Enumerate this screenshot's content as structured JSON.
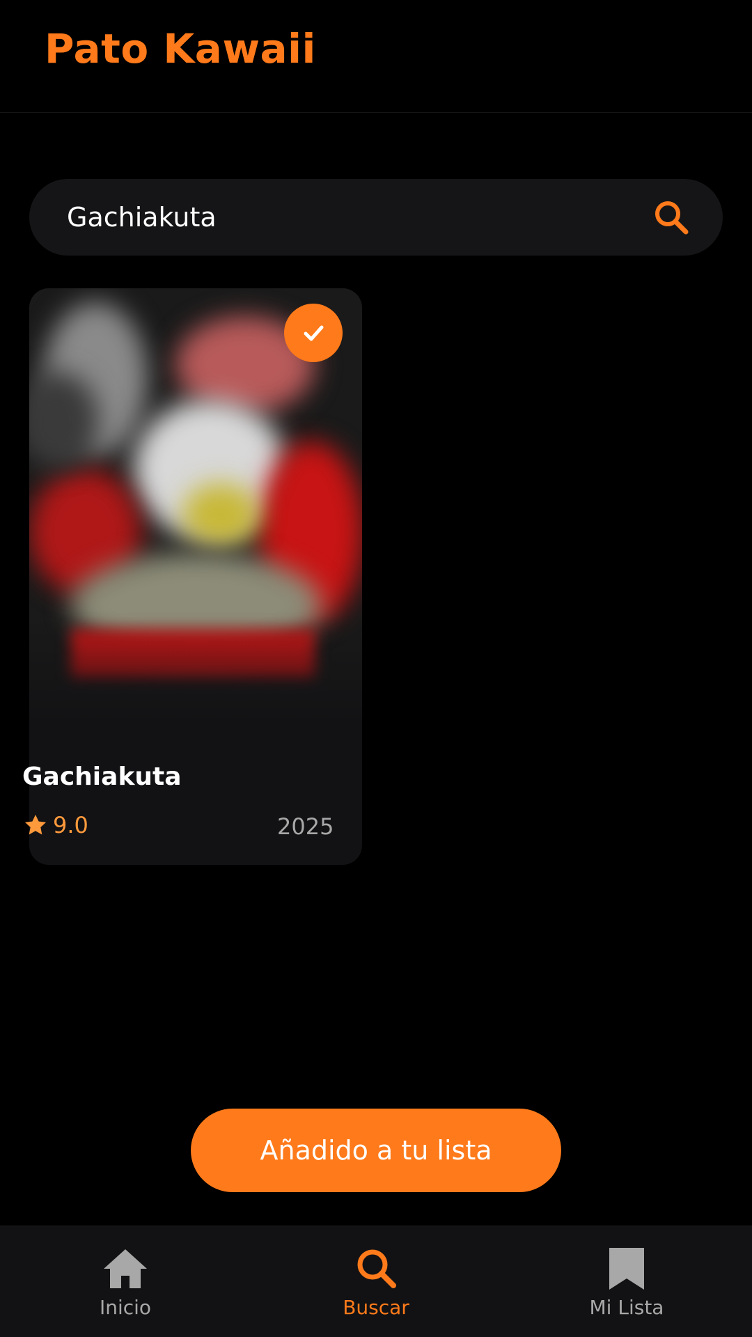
{
  "app": {
    "title": "Pato Kawaii",
    "accent_color": "#ff7a1a"
  },
  "search": {
    "value": "Gachiakuta",
    "icon": "search-icon"
  },
  "results": [
    {
      "title": "Gachiakuta",
      "rating": "9.0",
      "year": "2025",
      "in_list": true,
      "badge_icon": "check-icon",
      "rating_icon": "star-icon"
    }
  ],
  "toast": {
    "message": "Añadido a tu lista"
  },
  "bottom_nav": {
    "active": "Buscar",
    "items": [
      {
        "label": "Inicio",
        "icon": "home-icon"
      },
      {
        "label": "Buscar",
        "icon": "search-icon"
      },
      {
        "label": "Mi Lista",
        "icon": "bookmark-icon"
      }
    ]
  }
}
